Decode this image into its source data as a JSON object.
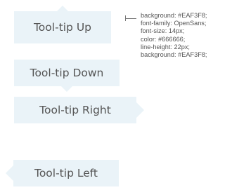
{
  "tooltips": {
    "up": "Tool-tip Up",
    "down": "Tool-tip Down",
    "right": "Tool-tip Right",
    "left": "Tool-tip Left"
  },
  "annotation": {
    "lines": [
      "background: #EAF3F8;",
      "font-family: OpenSans;",
      "font-size: 14px;",
      "color: #666666;",
      "line-height: 22px;",
      "background: #EAF3F8;"
    ]
  },
  "colors": {
    "tooltip_background": "#EAF3F8",
    "text": "#666666"
  }
}
